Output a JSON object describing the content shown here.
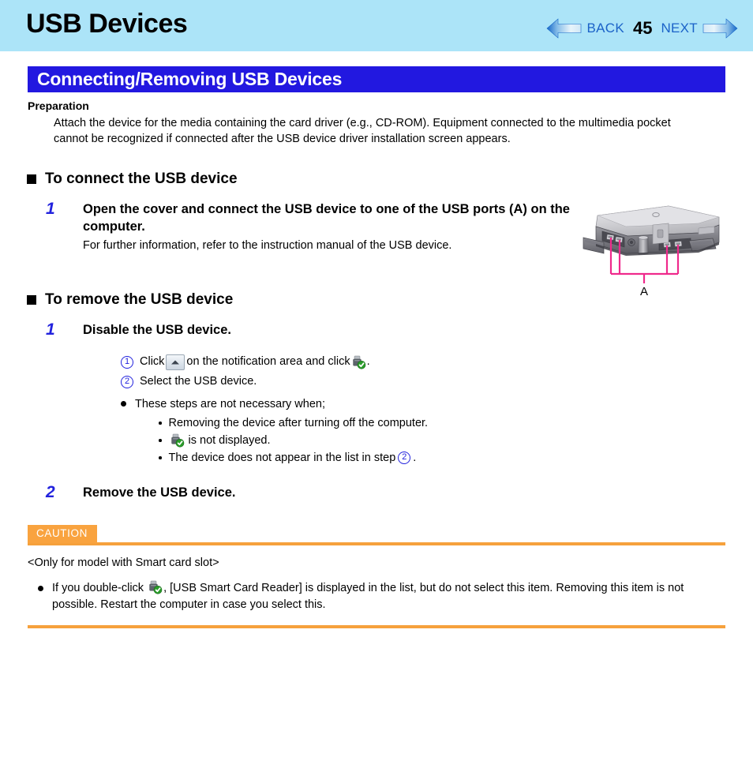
{
  "header": {
    "title": "USB Devices",
    "nav": {
      "back_label": "BACK",
      "page_number": "45",
      "next_label": "NEXT"
    },
    "band_color": "#ace4f8"
  },
  "section": {
    "bar_title": "Connecting/Removing USB Devices",
    "bar_color": "#2218e0"
  },
  "preparation": {
    "heading": "Preparation",
    "text": "Attach the device for the media containing the card driver (e.g., CD-ROM). Equipment connected to the multimedia pocket cannot be recognized if connected after the USB device driver installation screen appears."
  },
  "connect": {
    "heading": "To connect the USB device",
    "step1": {
      "number": "1",
      "title": "Open the cover and connect the USB device to one of the USB ports (A) on the computer.",
      "sub": "For further information, refer to the instruction manual of the USB device."
    },
    "figure": {
      "callout_label": "A",
      "callout_color": "#ef2a8c"
    }
  },
  "remove": {
    "heading": "To remove the USB device",
    "step1": {
      "number": "1",
      "title": "Disable the USB device.",
      "item1_pre": "Click",
      "item1_mid": "on the notification area and click",
      "item1_post": ".",
      "item1_num": "1",
      "item2_num": "2",
      "item2_text": "Select the USB device.",
      "bullet_text": "These steps are not necessary when;",
      "sub1": "Removing the device after turning off the computer.",
      "sub2_post": "is not displayed.",
      "sub3_pre": "The device does not appear in the list in step",
      "sub3_num": "2",
      "sub3_post": "."
    },
    "step2": {
      "number": "2",
      "title": "Remove the USB device."
    }
  },
  "caution": {
    "tag": "CAUTION",
    "tag_color": "#f9a33f",
    "note": "<Only for model with Smart card slot>",
    "bullet_pre": "If you double-click",
    "bullet_post": ", [USB Smart Card Reader] is displayed in the list, but do not select this item. Removing this item is not possible. Restart the computer in case you select this."
  }
}
